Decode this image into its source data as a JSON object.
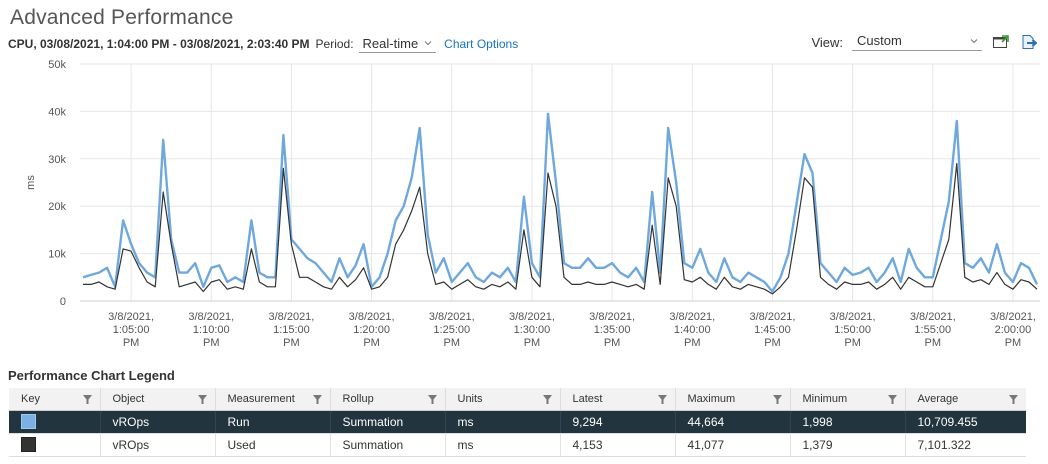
{
  "page_title": "Advanced Performance",
  "toolbar": {
    "range": "CPU, 03/08/2021, 1:04:00 PM - 03/08/2021, 2:03:40 PM",
    "period_label": "Period:",
    "period_value": "Real-time",
    "chart_options": "Chart Options",
    "view_label": "View:",
    "view_value": "Custom"
  },
  "chart_data": {
    "type": "line",
    "ylabel": "ms",
    "ylim": [
      0,
      50000
    ],
    "yticks": [
      "0",
      "10k",
      "20k",
      "30k",
      "40k",
      "50k"
    ],
    "xlim": [
      0,
      119
    ],
    "x_ticks": [
      {
        "i": 6,
        "label": [
          "3/8/2021,",
          "1:05:00",
          "PM"
        ]
      },
      {
        "i": 16,
        "label": [
          "3/8/2021,",
          "1:10:00",
          "PM"
        ]
      },
      {
        "i": 26,
        "label": [
          "3/8/2021,",
          "1:15:00",
          "PM"
        ]
      },
      {
        "i": 36,
        "label": [
          "3/8/2021,",
          "1:20:00",
          "PM"
        ]
      },
      {
        "i": 46,
        "label": [
          "3/8/2021,",
          "1:25:00",
          "PM"
        ]
      },
      {
        "i": 56,
        "label": [
          "3/8/2021,",
          "1:30:00",
          "PM"
        ]
      },
      {
        "i": 66,
        "label": [
          "3/8/2021,",
          "1:35:00",
          "PM"
        ]
      },
      {
        "i": 76,
        "label": [
          "3/8/2021,",
          "1:40:00",
          "PM"
        ]
      },
      {
        "i": 86,
        "label": [
          "3/8/2021,",
          "1:45:00",
          "PM"
        ]
      },
      {
        "i": 96,
        "label": [
          "3/8/2021,",
          "1:50:00",
          "PM"
        ]
      },
      {
        "i": 106,
        "label": [
          "3/8/2021,",
          "1:55:00",
          "PM"
        ]
      },
      {
        "i": 116,
        "label": [
          "3/8/2021,",
          "2:00:00",
          "PM"
        ]
      }
    ],
    "grid": true,
    "series": [
      {
        "name": "vROps Run",
        "color": "#6fa8dc",
        "values": [
          5000,
          5500,
          6000,
          7000,
          3000,
          17000,
          12000,
          8000,
          6000,
          5000,
          34000,
          13000,
          6000,
          6000,
          8000,
          3000,
          7000,
          7500,
          4000,
          5000,
          4000,
          17000,
          6000,
          5000,
          5000,
          35000,
          13000,
          11000,
          9000,
          8000,
          6000,
          4000,
          9000,
          5000,
          7500,
          12000,
          3000,
          5000,
          10000,
          17000,
          20000,
          26000,
          36500,
          14000,
          6000,
          9000,
          4000,
          6000,
          8000,
          5000,
          4000,
          6000,
          5000,
          7000,
          4000,
          22000,
          8000,
          5000,
          39500,
          25000,
          8000,
          7000,
          7000,
          9000,
          7000,
          7000,
          8000,
          6000,
          5000,
          7000,
          4000,
          23000,
          6000,
          36500,
          25000,
          8000,
          7000,
          11000,
          6000,
          4000,
          9000,
          5000,
          4000,
          6000,
          5000,
          4000,
          2000,
          5000,
          10000,
          20500,
          31000,
          27000,
          8000,
          6000,
          4000,
          7000,
          5500,
          6000,
          7000,
          4000,
          6000,
          9000,
          4000,
          11000,
          7000,
          5000,
          5000,
          13000,
          21000,
          38000,
          8000,
          7000,
          9000,
          6000,
          12000,
          6000,
          4000,
          8000,
          7000,
          3500
        ]
      },
      {
        "name": "vROps Used",
        "color": "#333333",
        "values": [
          3500,
          3500,
          4000,
          3000,
          2500,
          11000,
          10500,
          7000,
          4000,
          3000,
          23000,
          12000,
          3000,
          3500,
          4000,
          2000,
          4000,
          4500,
          2500,
          3000,
          2500,
          11000,
          4000,
          3000,
          3000,
          28000,
          12000,
          5000,
          5000,
          4000,
          3000,
          2500,
          5000,
          3000,
          4500,
          7000,
          2500,
          3000,
          5000,
          12000,
          15000,
          19000,
          24000,
          10000,
          3500,
          4000,
          2500,
          3500,
          4500,
          3000,
          2500,
          3500,
          3000,
          4000,
          2500,
          15000,
          5000,
          3000,
          27000,
          20000,
          5000,
          3500,
          3500,
          4000,
          3500,
          3500,
          4000,
          3500,
          3000,
          3500,
          2500,
          16000,
          3500,
          26000,
          20000,
          4500,
          4000,
          5000,
          3500,
          2500,
          5000,
          3000,
          2500,
          3500,
          3000,
          2500,
          1500,
          3000,
          5000,
          15000,
          26000,
          24000,
          5000,
          3500,
          2500,
          4000,
          3500,
          3500,
          4000,
          2500,
          3500,
          5000,
          2500,
          5000,
          4000,
          3000,
          3000,
          8000,
          13000,
          29000,
          5000,
          4000,
          4500,
          3500,
          6000,
          3500,
          2500,
          4500,
          4000,
          2500
        ]
      }
    ]
  },
  "legend": {
    "title": "Performance Chart Legend",
    "columns": [
      "Key",
      "Object",
      "Measurement",
      "Rollup",
      "Units",
      "Latest",
      "Maximum",
      "Minimum",
      "Average"
    ],
    "rows": [
      {
        "object": "vROps",
        "measurement": "Run",
        "rollup": "Summation",
        "units": "ms",
        "latest": "9,294",
        "maximum": "44,664",
        "minimum": "1,998",
        "average": "10,709.455"
      },
      {
        "object": "vROps",
        "measurement": "Used",
        "rollup": "Summation",
        "units": "ms",
        "latest": "4,153",
        "maximum": "41,077",
        "minimum": "1,379",
        "average": "7,101.322"
      }
    ]
  }
}
